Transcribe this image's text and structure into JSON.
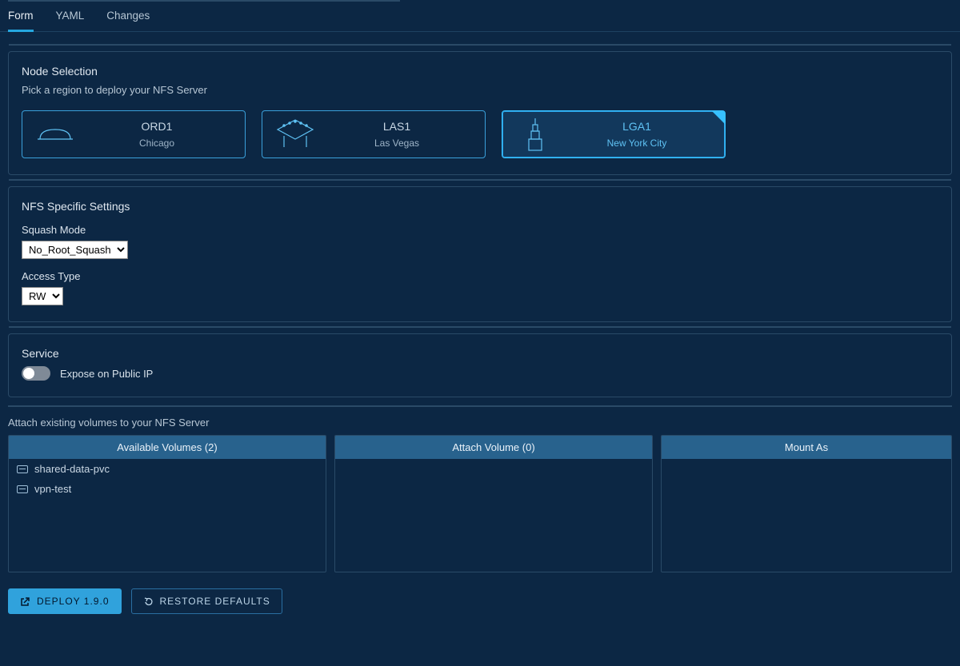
{
  "tabs": {
    "form": "Form",
    "yaml": "YAML",
    "changes": "Changes",
    "active": "form"
  },
  "node_selection": {
    "title": "Node Selection",
    "subtitle": "Pick a region to deploy your NFS Server",
    "regions": [
      {
        "code": "ORD1",
        "city": "Chicago",
        "selected": false
      },
      {
        "code": "LAS1",
        "city": "Las Vegas",
        "selected": false
      },
      {
        "code": "LGA1",
        "city": "New York City",
        "selected": true
      }
    ]
  },
  "nfs_settings": {
    "title": "NFS Specific Settings",
    "squash_label": "Squash Mode",
    "squash_value": "No_Root_Squash",
    "access_label": "Access Type",
    "access_value": "RW"
  },
  "service": {
    "title": "Service",
    "expose_label": "Expose on Public IP",
    "expose_value": false
  },
  "volumes": {
    "help": "Attach existing volumes to your NFS Server",
    "available_header": "Available Volumes (2)",
    "attach_header": "Attach Volume (0)",
    "mount_header": "Mount As",
    "available": [
      {
        "name": "shared-data-pvc"
      },
      {
        "name": "vpn-test"
      }
    ]
  },
  "footer": {
    "deploy": "DEPLOY 1.9.0",
    "restore": "RESTORE DEFAULTS"
  }
}
